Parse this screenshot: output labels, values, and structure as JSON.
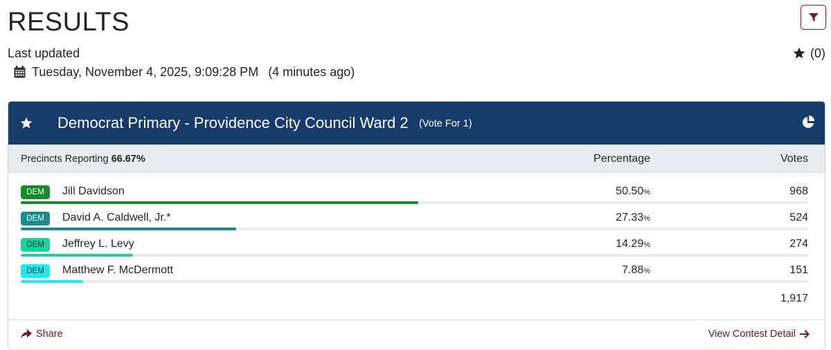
{
  "page": {
    "title": "RESULTS",
    "last_updated_label": "Last updated",
    "updated_datetime": "Tuesday, November 4, 2025, 9:09:28 PM",
    "updated_ago": "(4 minutes ago)",
    "favorites_count": "(0)"
  },
  "icons": {
    "filter": "filter-icon",
    "favorite": "star-icon",
    "calendar": "calendar-icon",
    "chart": "pie-chart-icon",
    "share": "share-icon",
    "arrow": "arrow-right-icon"
  },
  "colors": {
    "header_bg": "#173b6a",
    "accent": "#6b1a1f",
    "subheader_bg": "#e9ecef"
  },
  "contest": {
    "title": "Democrat Primary - Providence City Council Ward 2",
    "vote_for": "(Vote For 1)",
    "precincts_label": "Precincts Reporting",
    "precincts_value": "66.67%",
    "col_percentage": "Percentage",
    "col_votes": "Votes",
    "total_votes": "1,917",
    "share_label": "Share",
    "detail_label": "View Contest Detail",
    "candidates": [
      {
        "party": "DEM",
        "name": "Jill Davidson",
        "pct": "50.50",
        "pct_unit": "%",
        "votes": "968",
        "share": 0.505,
        "color": "#178c2a",
        "badge_bg": "#178c2a",
        "badge_fg": "#ffffff"
      },
      {
        "party": "DEM",
        "name": "David A. Caldwell, Jr.*",
        "pct": "27.33",
        "pct_unit": "%",
        "votes": "524",
        "share": 0.2733,
        "color": "#1a8a8a",
        "badge_bg": "#1a8a8a",
        "badge_fg": "#ffffff"
      },
      {
        "party": "DEM",
        "name": "Jeffrey L. Levy",
        "pct": "14.29",
        "pct_unit": "%",
        "votes": "274",
        "share": 0.1429,
        "color": "#1fcf9d",
        "badge_bg": "#1fcf9d",
        "badge_fg": "#0b3b2e"
      },
      {
        "party": "DEM",
        "name": "Matthew F. McDermott",
        "pct": "7.88",
        "pct_unit": "%",
        "votes": "151",
        "share": 0.0788,
        "color": "#27e6ee",
        "badge_bg": "#27e6ee",
        "badge_fg": "#0b3b3e"
      }
    ]
  }
}
